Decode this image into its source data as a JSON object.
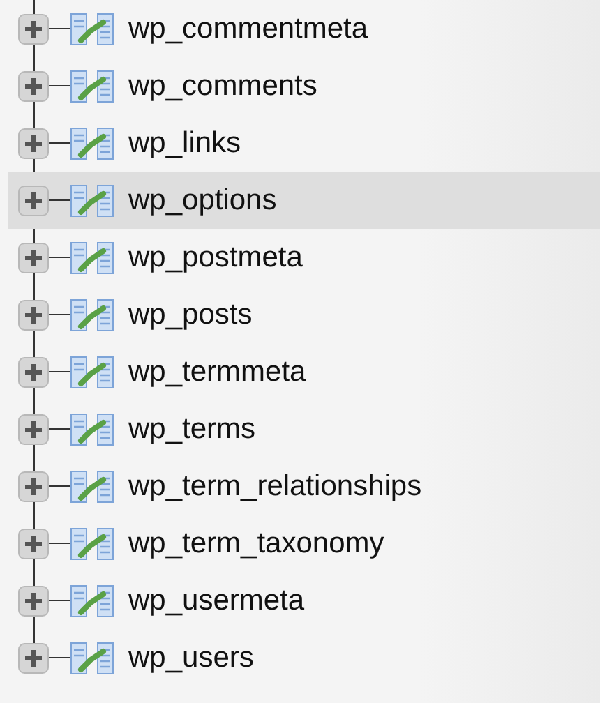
{
  "tables": [
    {
      "label": "wp_commentmeta",
      "selected": false,
      "expanded": false
    },
    {
      "label": "wp_comments",
      "selected": false,
      "expanded": false
    },
    {
      "label": "wp_links",
      "selected": false,
      "expanded": false
    },
    {
      "label": "wp_options",
      "selected": true,
      "expanded": false
    },
    {
      "label": "wp_postmeta",
      "selected": false,
      "expanded": false
    },
    {
      "label": "wp_posts",
      "selected": false,
      "expanded": false
    },
    {
      "label": "wp_termmeta",
      "selected": false,
      "expanded": false
    },
    {
      "label": "wp_terms",
      "selected": false,
      "expanded": false
    },
    {
      "label": "wp_term_relationships",
      "selected": false,
      "expanded": false
    },
    {
      "label": "wp_term_taxonomy",
      "selected": false,
      "expanded": false
    },
    {
      "label": "wp_usermeta",
      "selected": false,
      "expanded": false
    },
    {
      "label": "wp_users",
      "selected": false,
      "expanded": false
    }
  ]
}
